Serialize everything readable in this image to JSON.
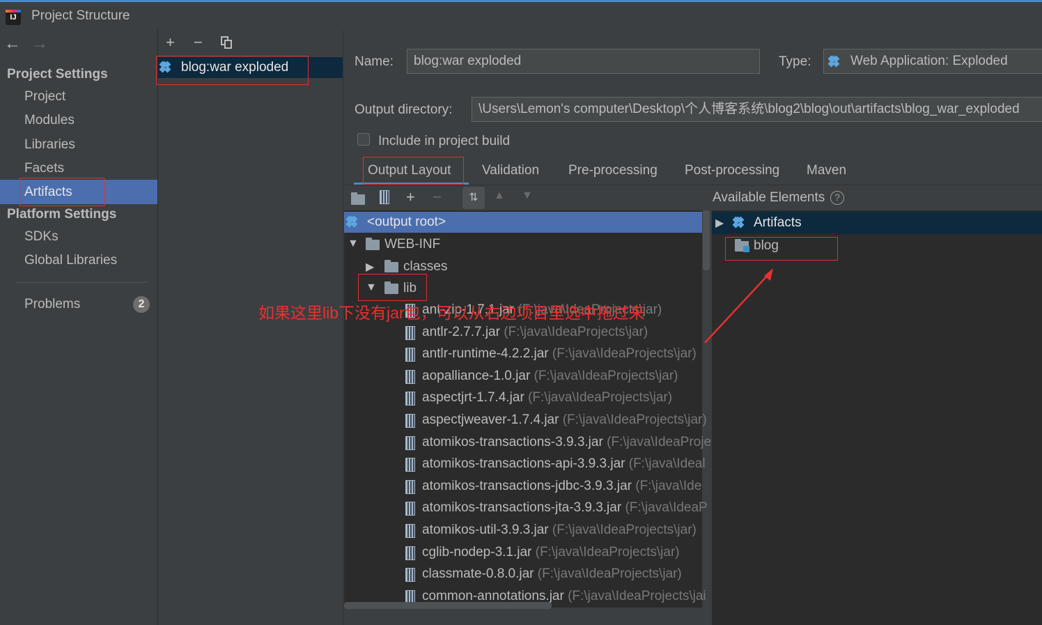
{
  "window": {
    "title": "Project Structure",
    "app_icon": "IJ"
  },
  "nav": {
    "back": "←",
    "forward": "→"
  },
  "sidebar": {
    "project_settings": "Project Settings",
    "items": [
      "Project",
      "Modules",
      "Libraries",
      "Facets",
      "Artifacts"
    ],
    "platform_settings": "Platform Settings",
    "platform_items": [
      "SDKs",
      "Global Libraries"
    ],
    "problems": "Problems",
    "problems_count": "2",
    "selected": "Artifacts"
  },
  "artifacts_panel": {
    "toolbar": {
      "add": "+",
      "remove": "−",
      "copy": "copy-icon"
    },
    "items": [
      "blog:war exploded"
    ]
  },
  "form": {
    "name_label": "Name:",
    "name_value": "blog:war exploded",
    "type_label": "Type:",
    "type_value": "Web Application: Exploded",
    "output_dir_label": "Output directory:",
    "output_dir_value": "\\Users\\Lemon's computer\\Desktop\\个人博客系统\\blog2\\blog\\out\\artifacts\\blog_war_exploded",
    "include_label": "Include in project build"
  },
  "tabs": [
    "Output Layout",
    "Validation",
    "Pre-processing",
    "Post-processing",
    "Maven"
  ],
  "active_tab": "Output Layout",
  "layout_tree": {
    "root": "<output root>",
    "web_inf": "WEB-INF",
    "classes": "classes",
    "lib": "lib",
    "jars": [
      {
        "name": "ant-zip-1.7.1.jar",
        "path": "(F:\\java\\IdeaProjects\\jar)"
      },
      {
        "name": "antlr-2.7.7.jar",
        "path": "(F:\\java\\IdeaProjects\\jar)"
      },
      {
        "name": "antlr-runtime-4.2.2.jar",
        "path": "(F:\\java\\IdeaProjects\\jar)"
      },
      {
        "name": "aopalliance-1.0.jar",
        "path": "(F:\\java\\IdeaProjects\\jar)"
      },
      {
        "name": "aspectjrt-1.7.4.jar",
        "path": "(F:\\java\\IdeaProjects\\jar)"
      },
      {
        "name": "aspectjweaver-1.7.4.jar",
        "path": "(F:\\java\\IdeaProjects\\jar)"
      },
      {
        "name": "atomikos-transactions-3.9.3.jar",
        "path": "(F:\\java\\IdeaProje"
      },
      {
        "name": "atomikos-transactions-api-3.9.3.jar",
        "path": "(F:\\java\\Ideal"
      },
      {
        "name": "atomikos-transactions-jdbc-3.9.3.jar",
        "path": "(F:\\java\\Ide"
      },
      {
        "name": "atomikos-transactions-jta-3.9.3.jar",
        "path": "(F:\\java\\IdeaP"
      },
      {
        "name": "atomikos-util-3.9.3.jar",
        "path": "(F:\\java\\IdeaProjects\\jar)"
      },
      {
        "name": "cglib-nodep-3.1.jar",
        "path": "(F:\\java\\IdeaProjects\\jar)"
      },
      {
        "name": "classmate-0.8.0.jar",
        "path": "(F:\\java\\IdeaProjects\\jar)"
      },
      {
        "name": "common-annotations.jar",
        "path": "(F:\\java\\IdeaProjects\\jai"
      }
    ]
  },
  "available": {
    "title": "Available Elements",
    "help": "?",
    "artifacts": "Artifacts",
    "blog": "blog"
  },
  "annotation": "如果这里lib下没有jar包，可以从右边项目里选中拖过来",
  "colors": {
    "accent": "#4a88c7",
    "selection": "#4b6eaf",
    "annotation": "#e8312f"
  }
}
